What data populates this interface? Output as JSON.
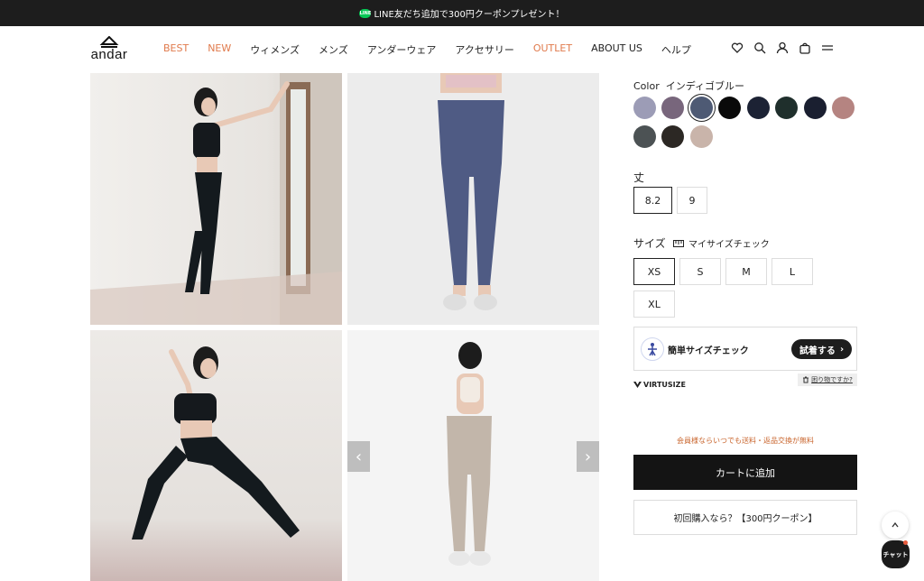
{
  "announcement": {
    "line_badge": "LINE",
    "text": "LINE友だち追加で300円クーポンプレゼント！"
  },
  "header": {
    "logo_text": "andar",
    "nav": [
      {
        "label": "BEST",
        "accent": true
      },
      {
        "label": "NEW",
        "accent": true
      },
      {
        "label": "ウィメンズ",
        "accent": false
      },
      {
        "label": "メンズ",
        "accent": false
      },
      {
        "label": "アンダーウェア",
        "accent": false
      },
      {
        "label": "アクセサリー",
        "accent": false
      },
      {
        "label": "OUTLET",
        "accent": true
      },
      {
        "label": "ABOUT US",
        "accent": false
      },
      {
        "label": "ヘルプ",
        "accent": false
      }
    ],
    "icons": [
      "heart-icon",
      "search-icon",
      "user-icon",
      "bag-icon",
      "menu-icon"
    ]
  },
  "gallery": {
    "prev_arrow": "‹",
    "next_arrow": "›"
  },
  "product": {
    "color_label": "Color",
    "color_value": "インディゴブルー",
    "swatches": [
      {
        "color": "#9c9cb6",
        "selected": false
      },
      {
        "color": "#78667c",
        "selected": false
      },
      {
        "color": "#4e5a74",
        "selected": true
      },
      {
        "color": "#0a0a0a",
        "selected": false
      },
      {
        "color": "#1c2234",
        "selected": false
      },
      {
        "color": "#1f2f2c",
        "selected": false
      },
      {
        "color": "#1a1f30",
        "selected": false
      },
      {
        "color": "#b58481",
        "selected": false
      },
      {
        "color": "#4c5254",
        "selected": false
      },
      {
        "color": "#2c2824",
        "selected": false
      },
      {
        "color": "#c9b4aa",
        "selected": false
      }
    ],
    "length_label": "丈",
    "lengths": [
      {
        "label": "8.2",
        "selected": true
      },
      {
        "label": "9",
        "selected": false
      }
    ],
    "size_label": "サイズ",
    "size_check": "マイサイズチェック",
    "sizes": [
      {
        "label": "XS",
        "selected": true
      },
      {
        "label": "S",
        "selected": false
      },
      {
        "label": "M",
        "selected": false
      },
      {
        "label": "L",
        "selected": false
      },
      {
        "label": "XL",
        "selected": false
      }
    ],
    "virtusize": {
      "title": "簡単サイズチェック",
      "try_button": "試着する",
      "brand": "VIRTUSIZE",
      "help": "困り物ですか?"
    },
    "promo_text": "会員様ならいつでも送料・返品交換が無料",
    "cart_button": "カートに追加",
    "coupon_button": "初回購入なら？【300円クーポン】"
  },
  "floating": {
    "chat_label": "チャット"
  },
  "colors": {
    "accent": "#e07a4c",
    "promo": "#c9652d",
    "dark": "#141414"
  }
}
